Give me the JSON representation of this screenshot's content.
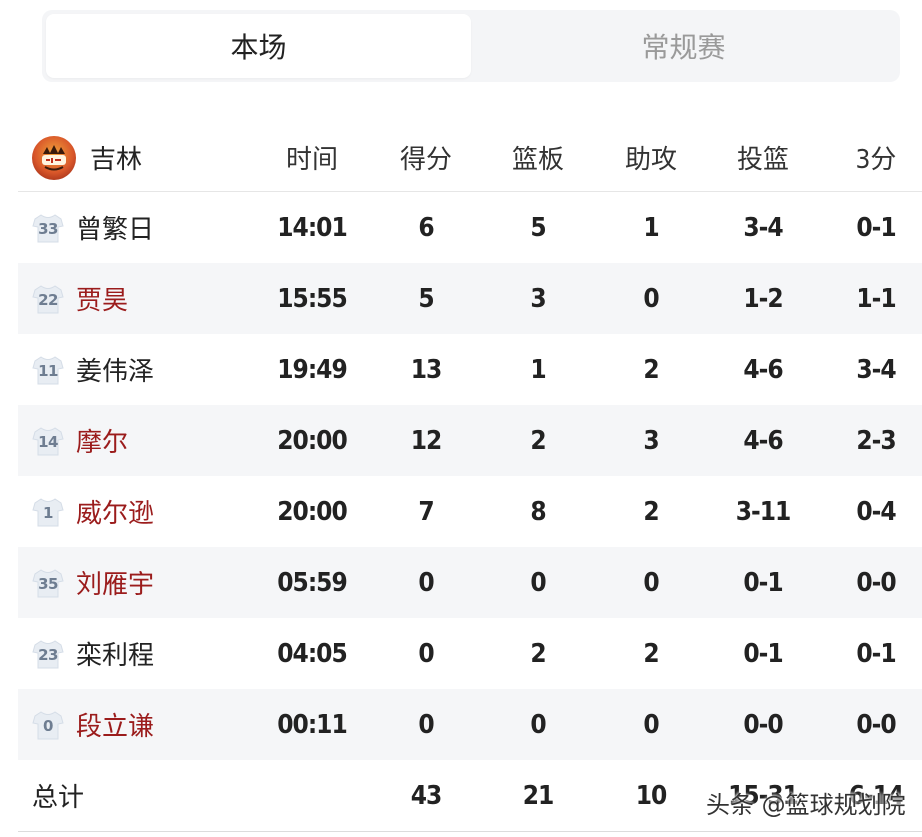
{
  "tabs": [
    {
      "label": "本场",
      "active": true
    },
    {
      "label": "常规赛",
      "active": false
    }
  ],
  "team": {
    "name": "吉林",
    "logo_icon": "jilin-team-logo"
  },
  "columns": {
    "time": "时间",
    "points": "得分",
    "rebounds": "篮板",
    "assists": "助攻",
    "fg": "投篮",
    "three": "3分"
  },
  "players": [
    {
      "number": "33",
      "name": "曾繁日",
      "foreign": false,
      "time": "14:01",
      "points": "6",
      "rebounds": "5",
      "assists": "1",
      "fg": "3-4",
      "three": "0-1"
    },
    {
      "number": "22",
      "name": "贾昊",
      "foreign": true,
      "time": "15:55",
      "points": "5",
      "rebounds": "3",
      "assists": "0",
      "fg": "1-2",
      "three": "1-1"
    },
    {
      "number": "11",
      "name": "姜伟泽",
      "foreign": false,
      "time": "19:49",
      "points": "13",
      "rebounds": "1",
      "assists": "2",
      "fg": "4-6",
      "three": "3-4"
    },
    {
      "number": "14",
      "name": "摩尔",
      "foreign": true,
      "time": "20:00",
      "points": "12",
      "rebounds": "2",
      "assists": "3",
      "fg": "4-6",
      "three": "2-3"
    },
    {
      "number": "1",
      "name": "威尔逊",
      "foreign": true,
      "time": "20:00",
      "points": "7",
      "rebounds": "8",
      "assists": "2",
      "fg": "3-11",
      "three": "0-4"
    },
    {
      "number": "35",
      "name": "刘雁宇",
      "foreign": true,
      "time": "05:59",
      "points": "0",
      "rebounds": "0",
      "assists": "0",
      "fg": "0-1",
      "three": "0-0"
    },
    {
      "number": "23",
      "name": "栾利程",
      "foreign": false,
      "time": "04:05",
      "points": "0",
      "rebounds": "2",
      "assists": "2",
      "fg": "0-1",
      "three": "0-1"
    },
    {
      "number": "0",
      "name": "段立谦",
      "foreign": true,
      "time": "00:11",
      "points": "0",
      "rebounds": "0",
      "assists": "0",
      "fg": "0-0",
      "three": "0-0"
    }
  ],
  "totals": {
    "label": "总计",
    "points": "43",
    "rebounds": "21",
    "assists": "10",
    "fg": "15-31",
    "three": "6-14"
  },
  "watermark": "头条 @篮球规划院",
  "colors": {
    "foreign_name": "#9b1c1c",
    "alt_row": "#f5f6f8",
    "tab_bg": "#f4f5f7",
    "jersey": "#6e7d91"
  }
}
